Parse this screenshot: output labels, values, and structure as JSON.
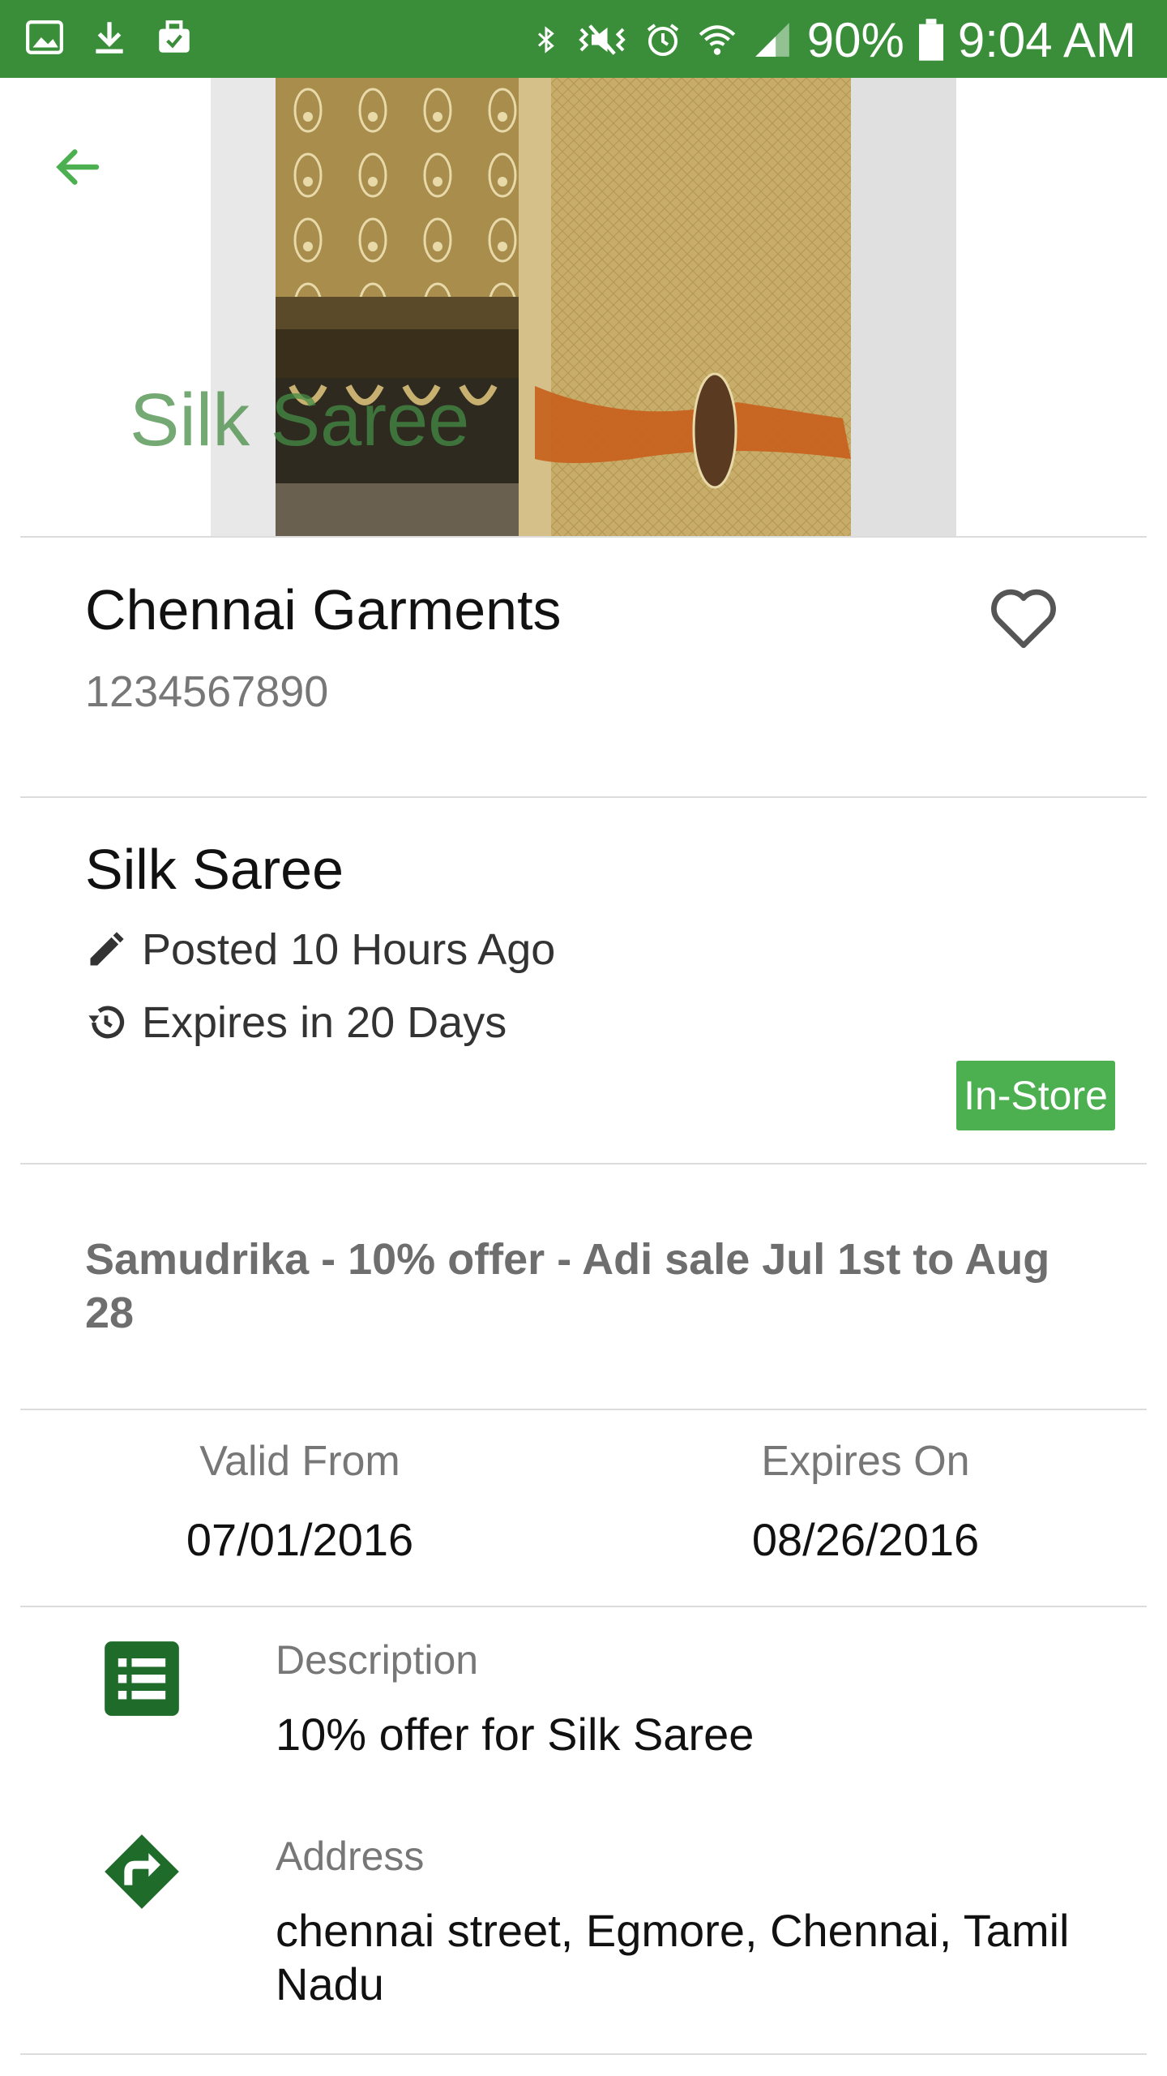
{
  "status_bar": {
    "battery": "90%",
    "time": "9:04 AM",
    "icons": [
      "image-icon",
      "download-icon",
      "briefcase-icon",
      "bluetooth-icon",
      "vibrate-icon",
      "alarm-icon",
      "wifi-icon",
      "signal-icon",
      "battery-icon"
    ]
  },
  "hero": {
    "title": "Silk Saree",
    "back_icon": "arrow-left-icon"
  },
  "store": {
    "name": "Chennai Garments",
    "phone": "1234567890",
    "favorite_icon": "heart-outline-icon"
  },
  "offer": {
    "title": "Silk Saree",
    "posted": "Posted 10 Hours Ago",
    "expires": "Expires in 20 Days",
    "badge": "In-Store"
  },
  "headline": "Samudrika - 10% offer - Adi sale Jul 1st to Aug 28",
  "validity": {
    "from_label": "Valid From",
    "from_value": "07/01/2016",
    "to_label": "Expires On",
    "to_value": "08/26/2016"
  },
  "details": {
    "description_label": "Description",
    "description_text": "10% offer for Silk Saree",
    "address_label": "Address",
    "address_text": "chennai street, Egmore, Chennai, Tamil Nadu"
  },
  "colors": {
    "status_bar": "#3a8e3a",
    "accent": "#4caf50",
    "icon_dark_green": "#1e6b2a"
  }
}
